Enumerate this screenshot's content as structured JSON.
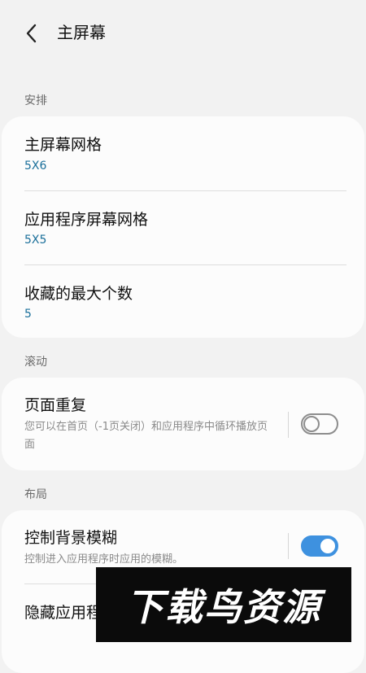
{
  "header": {
    "title": "主屏幕",
    "back_icon": "chevron-left-icon"
  },
  "sections": {
    "arrange": {
      "label": "安排",
      "items": [
        {
          "title": "主屏幕网格",
          "value": "5X6"
        },
        {
          "title": "应用程序屏幕网格",
          "value": "5X5"
        },
        {
          "title": "收藏的最大个数",
          "value": "5"
        }
      ]
    },
    "scroll": {
      "label": "滚动",
      "items": [
        {
          "title": "页面重复",
          "subtitle": "您可以在首页（-1页关闭）和应用程序中循环播放页面",
          "toggle": "off"
        }
      ]
    },
    "layout": {
      "label": "布局",
      "items": [
        {
          "title": "控制背景模糊",
          "subtitle": "控制进入应用程序时应用的模糊。",
          "toggle": "on"
        },
        {
          "title": "隐藏应用程序"
        }
      ]
    }
  },
  "watermark": {
    "text": "下载鸟资源"
  },
  "colors": {
    "background": "#f2f2f2",
    "card": "#fcfcfc",
    "accent": "#3e91df",
    "value_text": "#1a6f9a"
  }
}
